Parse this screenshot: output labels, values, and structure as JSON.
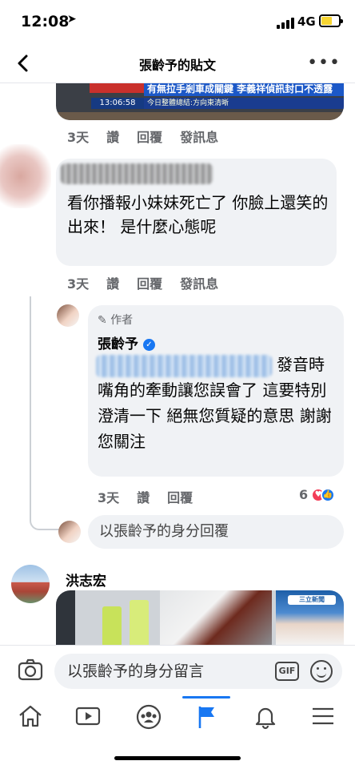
{
  "status_bar": {
    "time": "12:08",
    "network": "4G"
  },
  "header": {
    "title": "張齡予的貼文"
  },
  "top_video": {
    "headline": "有無拉手剎車成關鍵 李義祥偵訊封口不透露",
    "clock": "13:06:58",
    "ticker": "今日整體總結:方向東清晰"
  },
  "actions_labels": {
    "time": "3天",
    "like": "讚",
    "reply": "回覆",
    "message": "發訊息"
  },
  "comment1": {
    "text": "看你播報小妹妹死亡了 你臉上還笑的出來！ 是什麼心態呢"
  },
  "reply": {
    "author_badge": "作者",
    "name": "張齡予",
    "lead": "發音時",
    "text": "嘴角的牽動讓您誤會了 這要特別澄清一下 絕無您質疑的意思 謝謝您關注",
    "reaction_count": "6"
  },
  "reply_input": {
    "placeholder": "以張齡予的身分回覆"
  },
  "comment2": {
    "name": "洪志宏",
    "logo": "三立新聞"
  },
  "composer": {
    "placeholder": "以張齡予的身分留言",
    "gif_label": "GIF"
  },
  "icons": [
    "back-arrow-icon",
    "more-icon",
    "pencil-icon",
    "verified-icon",
    "heart-icon",
    "like-icon",
    "camera-icon",
    "gif-icon",
    "emoji-icon",
    "home-icon",
    "watch-icon",
    "groups-icon",
    "pages-flag-icon",
    "bell-icon",
    "menu-icon"
  ]
}
